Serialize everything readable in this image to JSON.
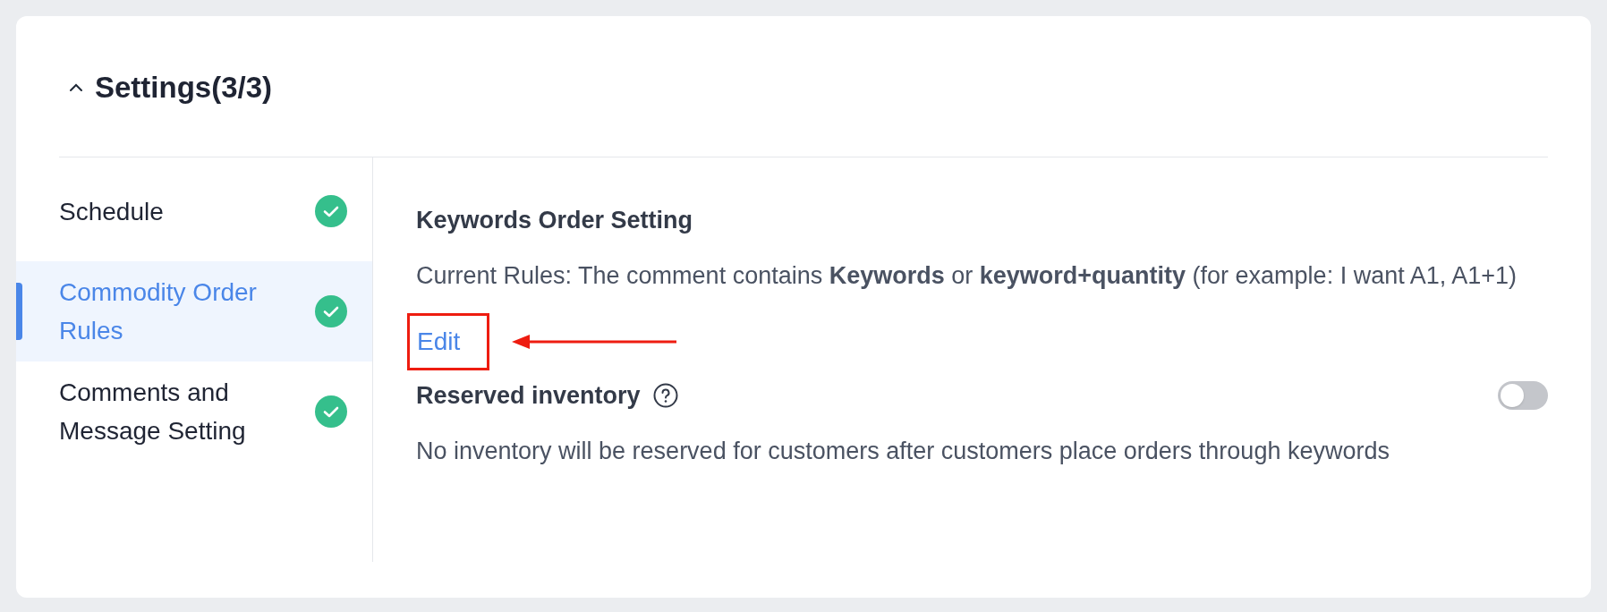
{
  "section": {
    "title": "Settings(3/3)",
    "expanded": true
  },
  "steps": [
    {
      "label": "Schedule",
      "selected": false,
      "done": true
    },
    {
      "label": "Commodity Order Rules",
      "selected": true,
      "done": true
    },
    {
      "label": "Comments and Message Setting",
      "selected": false,
      "done": true
    }
  ],
  "keywords_order": {
    "heading": "Keywords Order Setting",
    "rules": "Current Rules: The comment contains **Keywords** or **keyword+quantity** (for example: I want A1, A1+1)",
    "edit_link": "Edit",
    "highlighted": true
  },
  "reserved_inventory": {
    "label": "Reserved inventory",
    "on": false,
    "description": "No inventory will be reserved for customers after customers place orders through keywords"
  }
}
